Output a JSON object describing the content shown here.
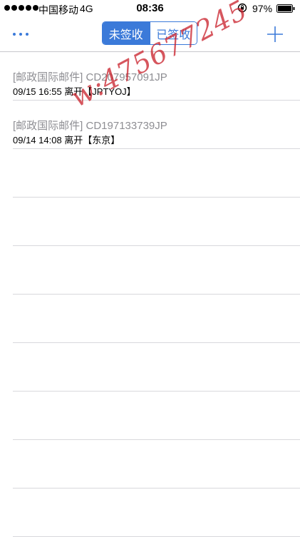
{
  "status_bar": {
    "carrier": "中国移动",
    "network": "4G",
    "time": "08:36",
    "battery": "97%"
  },
  "nav": {
    "more_icon": "more-dots-icon",
    "tabs": [
      {
        "label": "未签收",
        "active": true
      },
      {
        "label": "已签收",
        "active": false
      }
    ],
    "add_icon": "plus-icon",
    "accent_color": "#3b7ad9"
  },
  "packages": [
    {
      "title": "[邮政国际邮件] CD207957091JP",
      "subtitle": "09/15 16:55  离开【JPTYOJ】"
    },
    {
      "title": "[邮政国际邮件] CD197133739JP",
      "subtitle": "09/14 14:08  离开【东京】"
    },
    {
      "title": "",
      "subtitle": ""
    },
    {
      "title": "",
      "subtitle": ""
    },
    {
      "title": "",
      "subtitle": ""
    },
    {
      "title": "",
      "subtitle": ""
    },
    {
      "title": "",
      "subtitle": ""
    },
    {
      "title": "",
      "subtitle": ""
    },
    {
      "title": "",
      "subtitle": ""
    },
    {
      "title": "",
      "subtitle": ""
    }
  ],
  "watermark": "w:475677245"
}
